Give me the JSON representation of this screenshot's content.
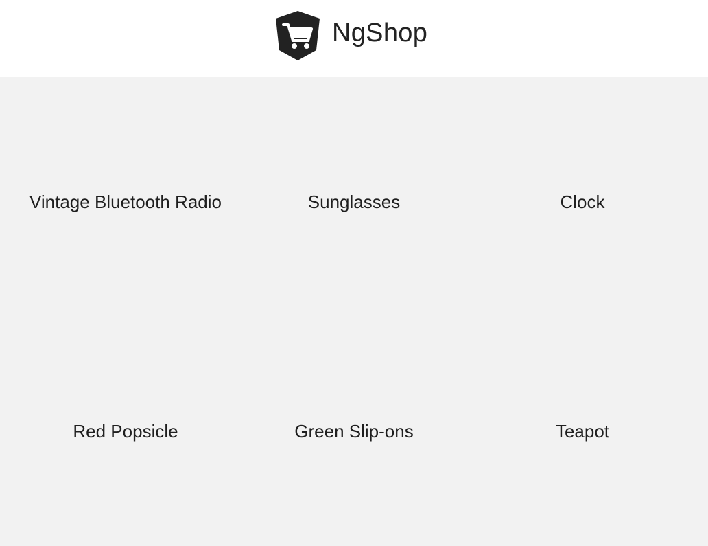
{
  "header": {
    "brand": {
      "name": "NgShop",
      "icon": "shopping-cart-icon",
      "logo_color": "#222222"
    }
  },
  "products": [
    {
      "name": "Vintage Bluetooth Radio"
    },
    {
      "name": "Sunglasses"
    },
    {
      "name": "Clock"
    },
    {
      "name": "Red Popsicle"
    },
    {
      "name": "Green Slip-ons"
    },
    {
      "name": "Teapot"
    }
  ],
  "colors": {
    "page_background": "#f2f2f2",
    "header_background": "#ffffff",
    "text": "#1f1f1f"
  }
}
